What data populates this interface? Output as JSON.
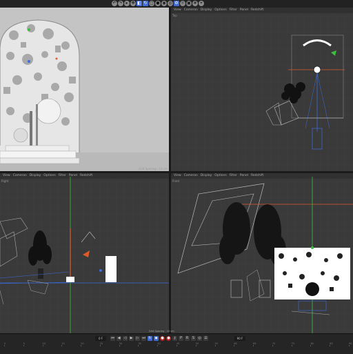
{
  "toolbar": {
    "icons": [
      "undo-icon",
      "redo-icon",
      "select-icon",
      "move-icon",
      "scale-icon",
      "rotate-icon",
      "cube-icon",
      "object-icon",
      "render-icon",
      "render-view-icon",
      "settings-icon",
      "light-icon",
      "camera-icon",
      "grid-icon",
      "snap-icon"
    ]
  },
  "viewports": {
    "top_right": {
      "label": "Top",
      "menu": [
        "View",
        "Cameras",
        "Display",
        "Options",
        "Filter",
        "Panel",
        "Redshift"
      ]
    },
    "bottom_left": {
      "label": "Right",
      "menu": [
        "View",
        "Cameras",
        "Display",
        "Options",
        "Filter",
        "Panel",
        "Redshift"
      ]
    },
    "bottom_right": {
      "label": "Front",
      "menu": [
        "View",
        "Cameras",
        "Display",
        "Options",
        "Filter",
        "Panel",
        "Redshift"
      ]
    },
    "render_view_note": "Grid Spacing : 10 cm"
  },
  "timeline": {
    "ruler_labels": [
      "0",
      "5",
      "10",
      "15",
      "20",
      "25",
      "30",
      "35",
      "40",
      "45",
      "50",
      "55",
      "60",
      "65",
      "70",
      "75",
      "80",
      "85",
      "90"
    ],
    "current_frame": "0 F",
    "end_frame": "90 F",
    "grid_spacing": "Grid Spacing : 10 cm"
  },
  "colors": {
    "accent": "#3f6bd2",
    "record": "#b22222",
    "axis_x": "#e05a2a",
    "axis_y": "#3cbf3c",
    "axis_z": "#3a6de0"
  }
}
